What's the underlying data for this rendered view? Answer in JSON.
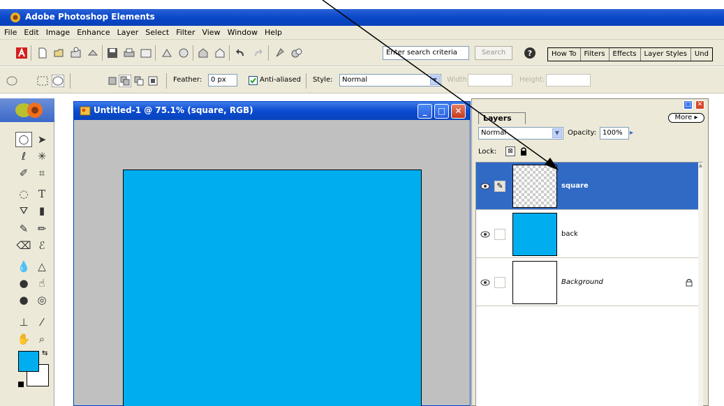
{
  "app": {
    "title": "Adobe Photoshop Elements"
  },
  "menu": [
    "File",
    "Edit",
    "Image",
    "Enhance",
    "Layer",
    "Select",
    "Filter",
    "View",
    "Window",
    "Help"
  ],
  "toolbar": {
    "search_placeholder": "Enter search criteria",
    "search_button": "Search",
    "tabs": [
      "How To",
      "Filters",
      "Effects",
      "Layer Styles",
      "Und"
    ]
  },
  "options": {
    "feather_label": "Feather:",
    "feather_value": "0 px",
    "antialiased_label": "Anti-aliased",
    "style_label": "Style:",
    "style_value": "Normal",
    "width_label": "Width:",
    "height_label": "Height:"
  },
  "document": {
    "title": "Untitled-1 @ 75.1% (square, RGB)",
    "canvas_color": "#00aeef"
  },
  "colors": {
    "foreground": "#00adef",
    "background": "#ffffff",
    "accent": "#316ac5"
  },
  "layers_panel": {
    "tab": "Layers",
    "more": "More",
    "blend_mode": "Normal",
    "opacity_label": "Opacity:",
    "opacity_value": "100%",
    "lock_label": "Lock:",
    "layers": [
      {
        "name": "square",
        "thumb": "transparent",
        "selected": true
      },
      {
        "name": "back",
        "thumb": "cyan",
        "selected": false
      },
      {
        "name": "Background",
        "thumb": "white",
        "selected": false,
        "locked": true
      }
    ]
  }
}
